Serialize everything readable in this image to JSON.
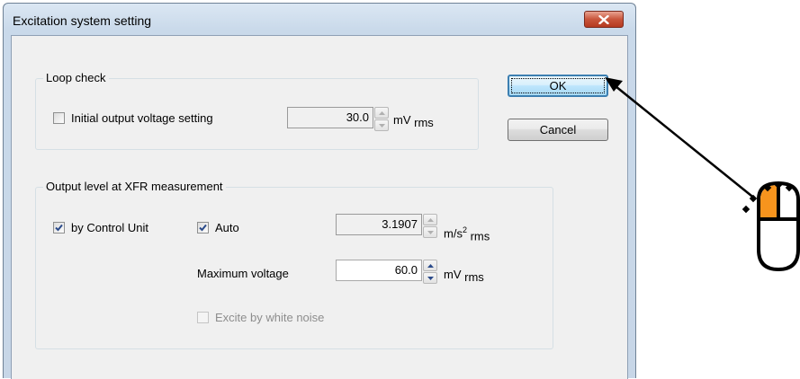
{
  "dialog": {
    "title": "Excitation system setting",
    "ok_label": "OK",
    "cancel_label": "Cancel"
  },
  "loop_check": {
    "group_label": "Loop check",
    "initial_output_label": "Initial output voltage setting",
    "initial_output_checked": false,
    "initial_output_value": "30.0",
    "unit_main": "mV",
    "unit_sub": "rms"
  },
  "output_level": {
    "group_label": "Output level at XFR measurement",
    "by_control_unit_label": "by Control Unit",
    "by_control_unit_checked": true,
    "auto_label": "Auto",
    "auto_checked": true,
    "accel_value": "3.1907",
    "accel_unit_main": "m/s",
    "accel_unit_sup": "2",
    "accel_unit_sub": "rms",
    "max_voltage_label": "Maximum voltage",
    "max_voltage_value": "60.0",
    "max_voltage_unit_main": "mV",
    "max_voltage_unit_sub": "rms",
    "white_noise_label": "Excite by white noise",
    "white_noise_checked": false
  },
  "annotation": {
    "icon": "mouse-left-click-icon",
    "accent_color": "#f7941d"
  }
}
